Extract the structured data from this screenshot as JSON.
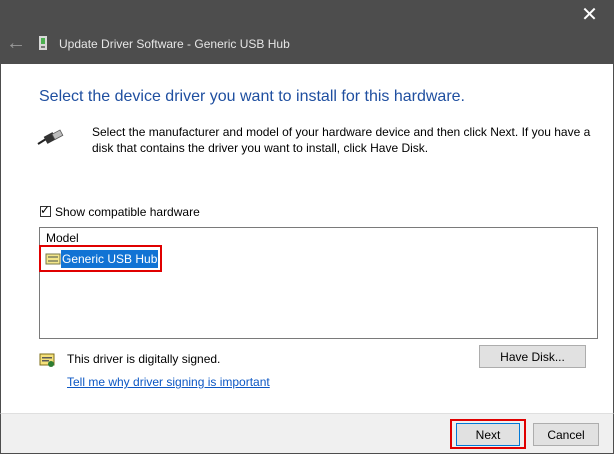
{
  "window": {
    "title": "Update Driver Software - Generic USB Hub",
    "close_glyph": "✕",
    "back_glyph": "←"
  },
  "main": {
    "heading": "Select the device driver you want to install for this hardware.",
    "description": "Select the manufacturer and model of your hardware device and then click Next. If you have a disk that contains the driver you want to install, click Have Disk.",
    "show_compatible": {
      "label": "Show compatible hardware",
      "checked": true,
      "mark": "✓"
    },
    "model_list": {
      "column_header": "Model",
      "items": [
        {
          "label": "Generic USB Hub",
          "selected": true
        }
      ]
    },
    "signing": {
      "status_text": "This driver is digitally signed.",
      "link_text": "Tell me why driver signing is important"
    },
    "have_disk_label": "Have Disk..."
  },
  "footer": {
    "next_label": "Next",
    "cancel_label": "Cancel"
  },
  "colors": {
    "title_bar": "#4d4d4d",
    "heading": "#1f4fa0",
    "selection": "#1173d4",
    "link": "#0c57c4",
    "highlight_box": "#e00000"
  }
}
